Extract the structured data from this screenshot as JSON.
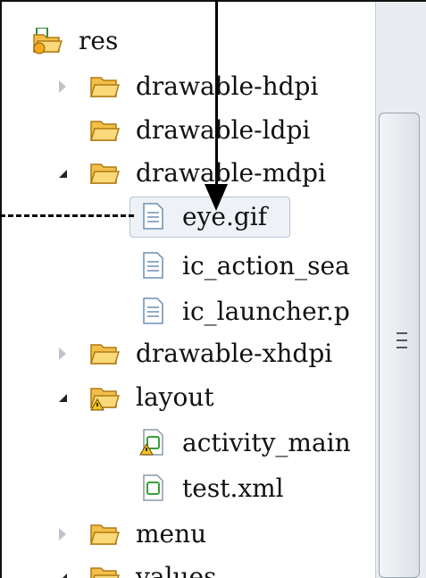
{
  "tree": {
    "items": [
      {
        "label": "res",
        "icon": "res-folder-icon",
        "twisty": "none"
      },
      {
        "label": "drawable-hdpi",
        "icon": "folder-icon",
        "twisty": "collapsed"
      },
      {
        "label": "drawable-ldpi",
        "icon": "folder-icon",
        "twisty": "none"
      },
      {
        "label": "drawable-mdpi",
        "icon": "folder-icon",
        "twisty": "expanded"
      },
      {
        "label": "eye.gif",
        "icon": "file-icon",
        "twisty": "none",
        "selected": true
      },
      {
        "label": "ic_action_sea",
        "icon": "file-icon",
        "twisty": "none"
      },
      {
        "label": "ic_launcher.p",
        "icon": "file-icon",
        "twisty": "none"
      },
      {
        "label": "drawable-xhdpi",
        "icon": "folder-icon",
        "twisty": "collapsed"
      },
      {
        "label": "layout",
        "icon": "warning-folder-icon",
        "twisty": "expanded"
      },
      {
        "label": "activity_main",
        "icon": "warning-xml-file-icon",
        "twisty": "none"
      },
      {
        "label": "test.xml",
        "icon": "xml-file-icon",
        "twisty": "none"
      },
      {
        "label": "menu",
        "icon": "folder-icon",
        "twisty": "collapsed"
      },
      {
        "label": "values",
        "icon": "folder-icon",
        "twisty": "expanded"
      }
    ]
  },
  "scrollbar": {
    "grip_icon": "grip-icon"
  },
  "colors": {
    "folder": "#f2c04a",
    "selection": "#eef2f7",
    "scroll_track": "#e9ecf0"
  }
}
